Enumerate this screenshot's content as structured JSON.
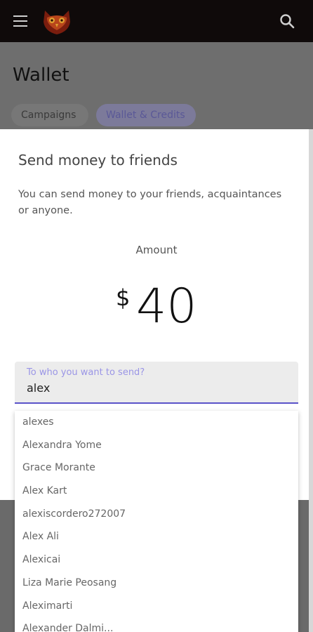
{
  "topbar": {
    "menu_icon": "hamburger-menu-icon",
    "logo_icon": "owl-logo",
    "search_icon": "search-icon"
  },
  "page": {
    "title": "Wallet",
    "tabs": [
      {
        "label": "Campaigns"
      },
      {
        "label": "Wallet & Credits"
      }
    ]
  },
  "modal": {
    "title": "Send money to friends",
    "description": "You can send money to your friends, acquaintances or anyone.",
    "amount_label": "Amount",
    "currency_symbol": "$",
    "amount_value": "40",
    "recipient_field": {
      "label": "To who you want to send?",
      "value": "alex"
    },
    "suggestions": [
      "alexes",
      "Alexandra Yome",
      "Grace Morante",
      "Alex Kart",
      "alexiscordero272007",
      "Alex Ali",
      "Alexicai",
      "Liza Marie Peosang",
      "Aleximarti",
      "Alexander Dalmi..."
    ]
  },
  "colors": {
    "topbar": "#0f0a0a",
    "accent": "#5a53c9",
    "overlay": "#6e6e6e"
  }
}
